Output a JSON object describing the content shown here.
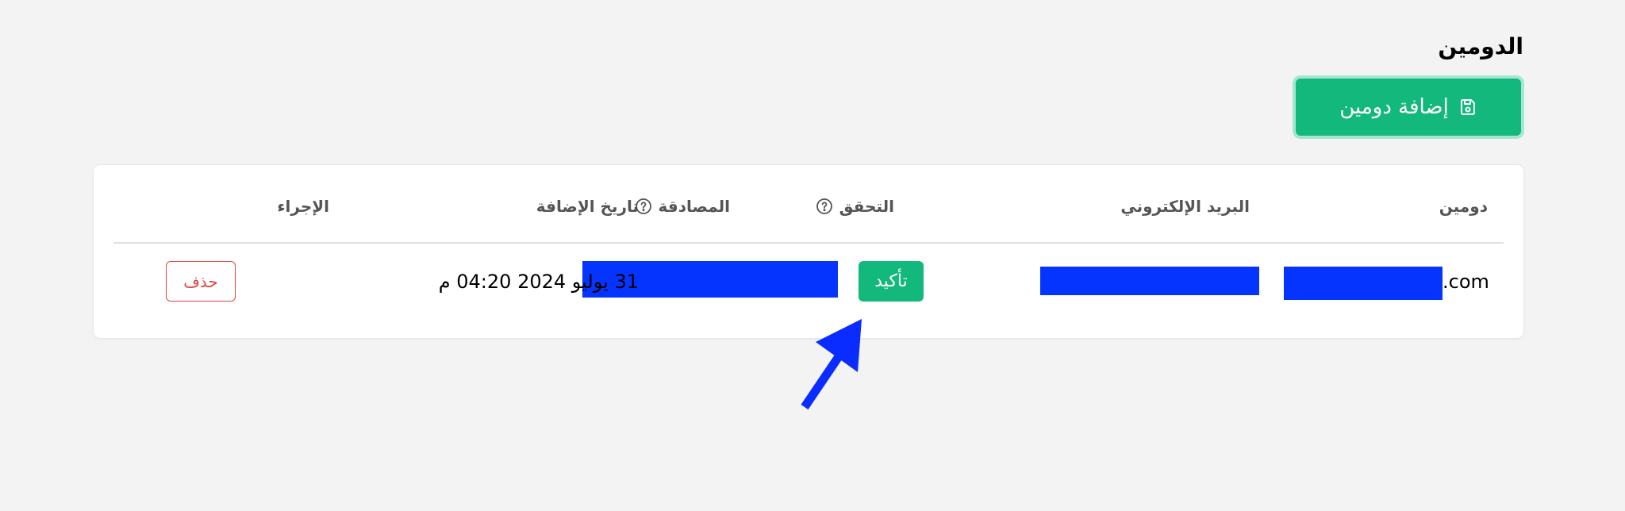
{
  "page": {
    "title": "الدومين"
  },
  "toolbar": {
    "add_domain_label": "إضافة دومين",
    "add_domain_icon": "save-icon"
  },
  "table": {
    "headers": {
      "domain": "دومين",
      "email": "البريد الإلكتروني",
      "verification": "التحقق",
      "authentication": "المصادقة",
      "date_added": "تاريخ الإضافة",
      "action": "الإجراء"
    },
    "help_icon": "question-circle-icon",
    "rows": [
      {
        "domain_suffix": ".com",
        "verify_label": "تأكيد",
        "date_added": "31 يوليو 2024 04:20 م",
        "delete_label": "حذف"
      }
    ]
  },
  "colors": {
    "accent_green": "#12b87c",
    "danger_red": "#e0443e",
    "redaction_blue": "#0634ff",
    "annotation_arrow": "#0a2cff"
  }
}
